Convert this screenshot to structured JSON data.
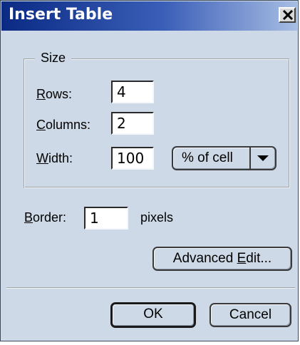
{
  "dialog": {
    "title": "Insert Table"
  },
  "size_group": {
    "legend": "Size",
    "rows_label_ul": "R",
    "rows_label_rest": "ows:",
    "rows_value": "4",
    "columns_label_ul": "C",
    "columns_label_rest": "olumns:",
    "columns_value": "2",
    "width_label_ul": "W",
    "width_label_rest": "idth:",
    "width_value": "100",
    "width_unit": "% of cell"
  },
  "border": {
    "label_ul": "B",
    "label_rest": "order:",
    "value": "1",
    "unit": "pixels"
  },
  "buttons": {
    "advanced_pre": "Advanced ",
    "advanced_ul": "E",
    "advanced_post": "dit...",
    "ok": "OK",
    "cancel": "Cancel"
  },
  "icons": {
    "close": "close-icon",
    "dropdown": "chevron-down-icon"
  },
  "colors": {
    "dialog_bg": "#cdd9e6",
    "titlebar_start": "#0a2a84",
    "titlebar_end": "#a7bde3"
  }
}
